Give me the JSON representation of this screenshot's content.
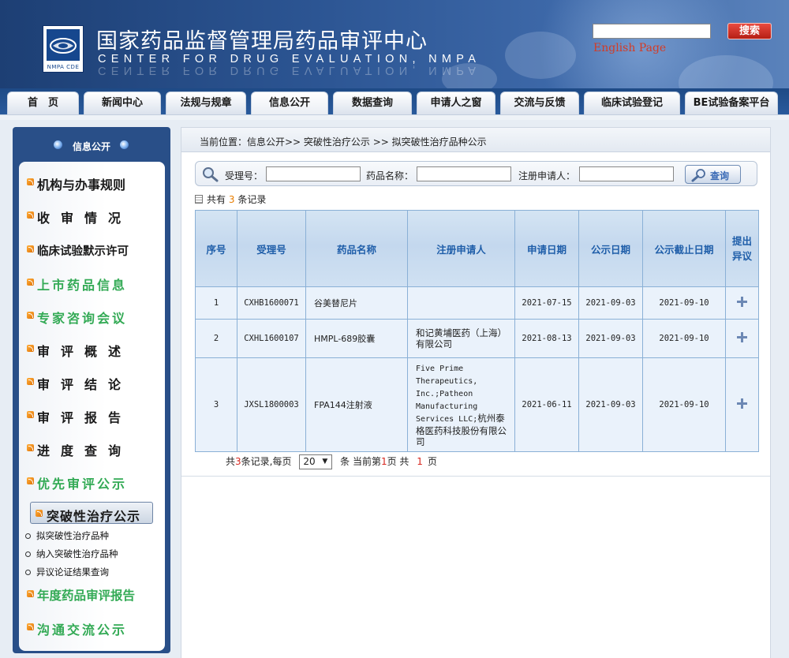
{
  "header": {
    "logo_text": "NMPA CDE",
    "title": "国家药品监督管理局药品审评中心",
    "subtitle": "CENTER FOR DRUG EVALUATION, NMPA",
    "search_value": "",
    "search_button": "搜索",
    "english_link": "English Page"
  },
  "nav": {
    "tabs": [
      {
        "label": "首　页"
      },
      {
        "label": "新闻中心"
      },
      {
        "label": "法规与规章"
      },
      {
        "label": "信息公开"
      },
      {
        "label": "数据查询"
      },
      {
        "label": "申请人之窗"
      },
      {
        "label": "交流与反馈"
      },
      {
        "label": "临床试验登记"
      },
      {
        "label": "BE试验备案平台"
      }
    ],
    "active": "信息公开"
  },
  "sidebar": {
    "heading": "信息公开",
    "items": [
      {
        "label": "机构与办事规则"
      },
      {
        "label": "收审情况"
      },
      {
        "label": "临床试验默示许可"
      },
      {
        "label": "上市药品信息"
      },
      {
        "label": "专家咨询会议"
      },
      {
        "label": "审评概述"
      },
      {
        "label": "审评结论"
      },
      {
        "label": "审评报告"
      },
      {
        "label": "进度查询"
      },
      {
        "label": "优先审评公示"
      },
      {
        "label": "突破性治疗公示"
      },
      {
        "label": "年度药品审评报告"
      },
      {
        "label": "沟通交流公示"
      }
    ],
    "sub_items": [
      {
        "label": "拟突破性治疗品种"
      },
      {
        "label": "纳入突破性治疗品种"
      },
      {
        "label": "异议论证结果查询"
      }
    ]
  },
  "breadcrumb": "当前位置：信息公开>> 突破性治疗公示 >> 拟突破性治疗品种公示",
  "query": {
    "fields": [
      {
        "label": "受理号：",
        "value": ""
      },
      {
        "label": "药品名称：",
        "value": ""
      },
      {
        "label": "注册申请人：",
        "value": ""
      }
    ],
    "button": "查询"
  },
  "summary": {
    "prefix": "共有",
    "count": "3",
    "suffix": "条记录"
  },
  "table": {
    "columns": [
      "序号",
      "受理号",
      "药品名称",
      "注册申请人",
      "申请日期",
      "公示日期",
      "公示截止日期",
      "提出异议"
    ],
    "rows": [
      {
        "no": "1",
        "acceptance": "CXHB1600071",
        "drug": "谷美替尼片",
        "applicant": "",
        "apply_date": "2021-07-15",
        "publish_date": "2021-09-03",
        "deadline": "2021-09-10"
      },
      {
        "no": "2",
        "acceptance": "CXHL1600107",
        "drug": "HMPL-689胶囊",
        "applicant": "和记黄埔医药（上海）有限公司",
        "apply_date": "2021-08-13",
        "publish_date": "2021-09-03",
        "deadline": "2021-09-10"
      },
      {
        "no": "3",
        "acceptance": "JXSL1800003",
        "drug": "FPA144注射液",
        "applicant_latin": "Five Prime Therapeutics, Inc.;Patheon Manufacturing Services LLC;",
        "applicant_cn": "杭州泰格医药科技股份有限公司",
        "apply_date": "2021-06-11",
        "publish_date": "2021-09-03",
        "deadline": "2021-09-10"
      }
    ]
  },
  "pager": {
    "t1": "共",
    "total": "3",
    "t2": "条记录,每页",
    "per_page": "20",
    "t3": "条 当前第",
    "current": "1",
    "t4": "页 共",
    "pages": "1",
    "t5": "页"
  },
  "icons": [
    "magnifier-icon",
    "rss-icon",
    "plus-icon",
    "document-icon",
    "chevron-down-icon"
  ],
  "colors": {
    "brand_blue": "#294f88",
    "header_blue": "#2c5593",
    "search_red": "#c8281e",
    "table_header": "#c4d8ee",
    "link_red": "#d43b25"
  }
}
